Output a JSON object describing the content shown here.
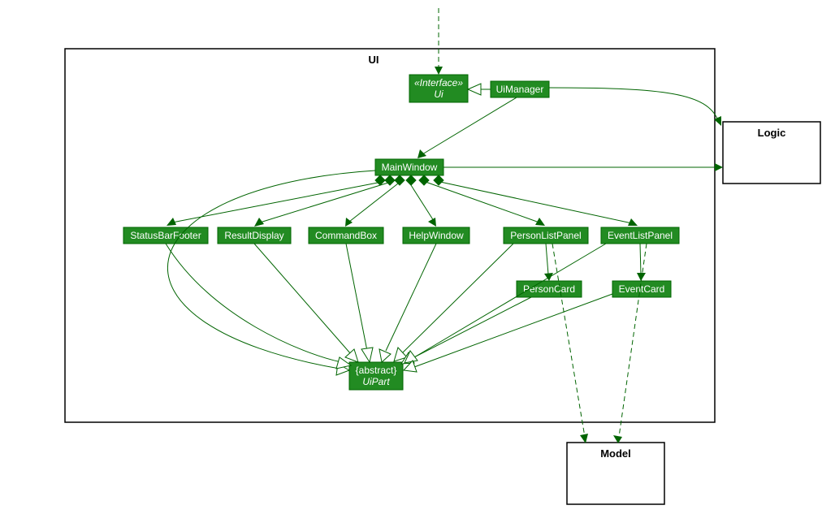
{
  "package": {
    "title": "UI"
  },
  "classes": {
    "interface_ui": {
      "stereotype": "«Interface»",
      "name": "Ui"
    },
    "ui_manager": {
      "name": "UiManager"
    },
    "main_window": {
      "name": "MainWindow"
    },
    "status_bar_footer": {
      "name": "StatusBarFooter"
    },
    "result_display": {
      "name": "ResultDisplay"
    },
    "command_box": {
      "name": "CommandBox"
    },
    "help_window": {
      "name": "HelpWindow"
    },
    "person_list_panel": {
      "name": "PersonListPanel"
    },
    "event_list_panel": {
      "name": "EventListPanel"
    },
    "person_card": {
      "name": "PersonCard"
    },
    "event_card": {
      "name": "EventCard"
    },
    "ui_part": {
      "stereotype": "{abstract}",
      "name": "UiPart"
    }
  },
  "external": {
    "logic": {
      "name": "Logic"
    },
    "model": {
      "name": "Model"
    }
  },
  "colors": {
    "class_fill": "#228B22",
    "class_stroke": "#006400",
    "line": "#006400"
  }
}
